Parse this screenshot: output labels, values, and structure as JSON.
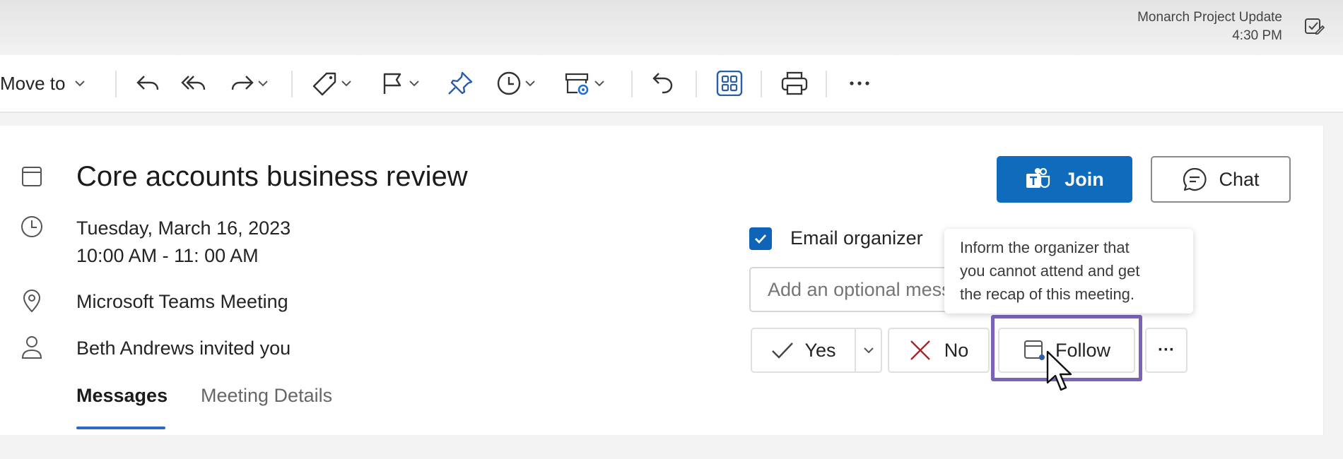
{
  "notification": {
    "title": "Monarch Project Update",
    "time": "4:30 PM",
    "icon": "checkmark-edit-icon"
  },
  "toolbar": {
    "move_to_label": "Move to",
    "icons": [
      "reply-icon",
      "reply-all-icon",
      "forward-icon",
      "tag-icon",
      "flag-icon",
      "pin-icon",
      "clock-icon",
      "rules-icon",
      "undo-icon",
      "apps-icon",
      "print-icon",
      "more-icon"
    ]
  },
  "event": {
    "title": "Core accounts business review",
    "date": "Tuesday, March 16, 2023",
    "time": "10:00 AM - 11: 00 AM",
    "location": "Microsoft Teams Meeting",
    "invited_by": "Beth Andrews invited you"
  },
  "tabs": [
    {
      "label": "Messages",
      "active": true
    },
    {
      "label": "Meeting Details",
      "active": false
    }
  ],
  "actions": {
    "join_label": "Join",
    "chat_label": "Chat"
  },
  "rsvp": {
    "email_organizer_label": "Email organizer",
    "email_organizer_checked": true,
    "message_placeholder": "Add an optional message",
    "yes_label": "Yes",
    "no_label": "No",
    "follow_label": "Follow",
    "more_label": "···"
  },
  "tooltip": {
    "lines": [
      "Inform the organizer that",
      "you cannot attend and get",
      "the recap of this meeting."
    ]
  },
  "colors": {
    "accent": "#0f6cbd",
    "highlight": "#7b64b8",
    "no_x": "#a4262c"
  }
}
